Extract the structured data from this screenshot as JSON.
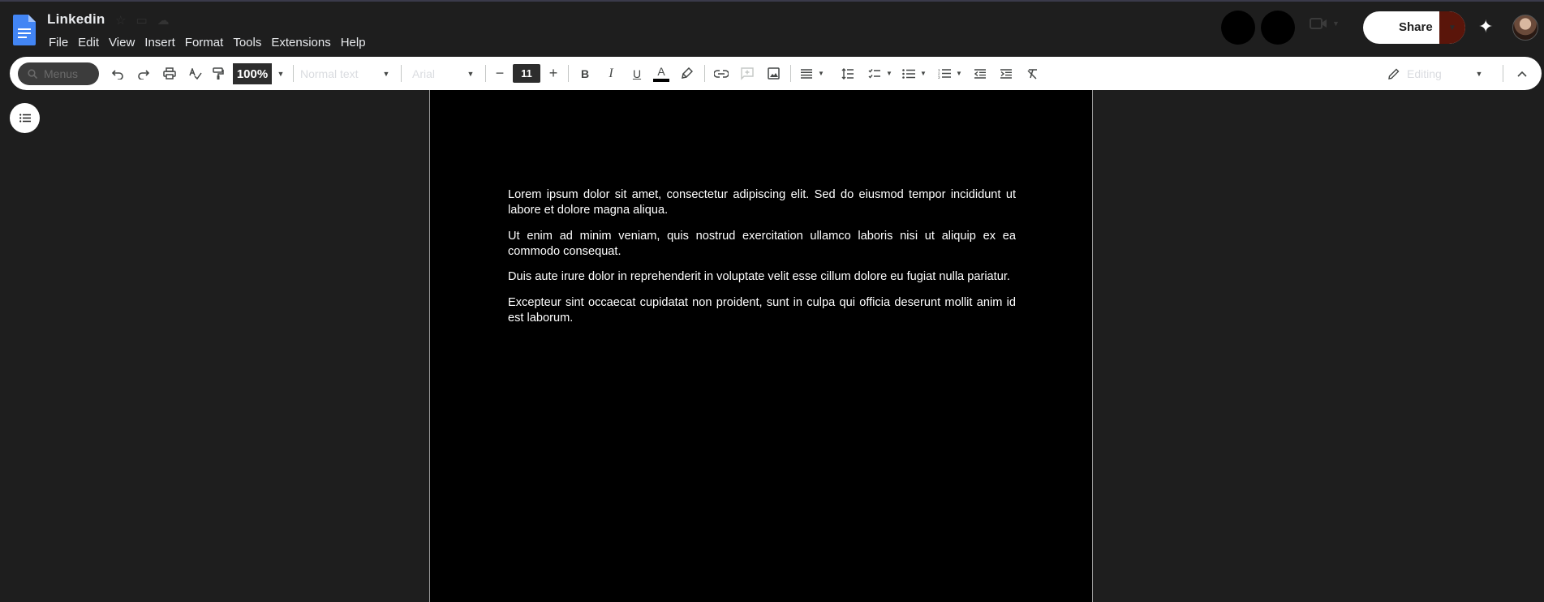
{
  "app": {
    "title": "Linkedin",
    "menus": [
      "File",
      "Edit",
      "View",
      "Insert",
      "Format",
      "Tools",
      "Extensions",
      "Help"
    ]
  },
  "header": {
    "share_label": "Share"
  },
  "toolbar": {
    "search_placeholder": "Menus",
    "zoom": "100%",
    "style": "Normal text",
    "font": "Arial",
    "font_size": "11",
    "mode": "Editing"
  },
  "document": {
    "paragraphs": [
      "Lorem ipsum dolor sit amet, consectetur adipiscing elit. Sed do eiusmod tempor incididunt ut labore et dolore magna aliqua.",
      "Ut enim ad minim veniam, quis nostrud exercitation ullamco laboris nisi ut aliquip ex ea commodo consequat.",
      "Duis aute irure dolor in reprehenderit in voluptate velit esse cillum dolore eu fugiat nulla pariatur.",
      "Excepteur sint occaecat cupidatat non proident, sunt in culpa qui officia deserunt mollit anim id est laborum."
    ]
  },
  "colors": {
    "accent": "#1a73e8",
    "share_dropdown": "#5a150a",
    "page_background": "#000000"
  }
}
